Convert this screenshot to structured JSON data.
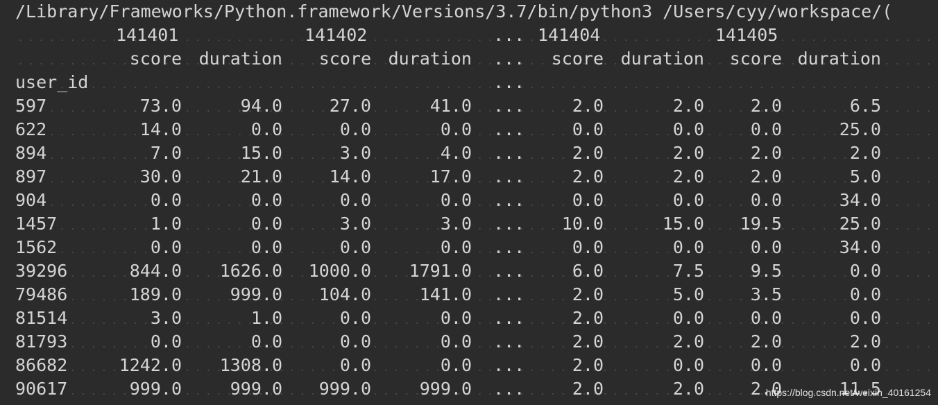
{
  "console": {
    "command_line": "/Library/Frameworks/Python.framework/Versions/3.7/bin/python3 /Users/cyy/workspace/(",
    "ellipsis": "...",
    "index_name": "user_id",
    "column_groups": [
      "141401",
      "141402",
      "141404",
      "141405"
    ],
    "sub_headers": [
      "score",
      "duration",
      "score",
      "duration",
      "score",
      "duration",
      "score",
      "duration"
    ],
    "rows": [
      {
        "id": "597",
        "values": [
          "73.0",
          "94.0",
          "27.0",
          "41.0",
          "2.0",
          "2.0",
          "2.0",
          "6.5"
        ]
      },
      {
        "id": "622",
        "values": [
          "14.0",
          "0.0",
          "0.0",
          "0.0",
          "0.0",
          "0.0",
          "0.0",
          "25.0"
        ]
      },
      {
        "id": "894",
        "values": [
          "7.0",
          "15.0",
          "3.0",
          "4.0",
          "2.0",
          "2.0",
          "2.0",
          "2.0"
        ]
      },
      {
        "id": "897",
        "values": [
          "30.0",
          "21.0",
          "14.0",
          "17.0",
          "2.0",
          "2.0",
          "2.0",
          "5.0"
        ]
      },
      {
        "id": "904",
        "values": [
          "0.0",
          "0.0",
          "0.0",
          "0.0",
          "0.0",
          "0.0",
          "0.0",
          "34.0"
        ]
      },
      {
        "id": "1457",
        "values": [
          "1.0",
          "0.0",
          "3.0",
          "3.0",
          "10.0",
          "15.0",
          "19.5",
          "25.0"
        ]
      },
      {
        "id": "1562",
        "values": [
          "0.0",
          "0.0",
          "0.0",
          "0.0",
          "0.0",
          "0.0",
          "0.0",
          "34.0"
        ]
      },
      {
        "id": "39296",
        "values": [
          "844.0",
          "1626.0",
          "1000.0",
          "1791.0",
          "6.0",
          "7.5",
          "9.5",
          "0.0"
        ]
      },
      {
        "id": "79486",
        "values": [
          "189.0",
          "999.0",
          "104.0",
          "141.0",
          "2.0",
          "5.0",
          "3.5",
          "0.0"
        ]
      },
      {
        "id": "81514",
        "values": [
          "3.0",
          "1.0",
          "0.0",
          "0.0",
          "2.0",
          "0.0",
          "0.0",
          "0.0"
        ]
      },
      {
        "id": "81793",
        "values": [
          "0.0",
          "0.0",
          "0.0",
          "0.0",
          "2.0",
          "2.0",
          "2.0",
          "2.0"
        ]
      },
      {
        "id": "86682",
        "values": [
          "1242.0",
          "1308.0",
          "0.0",
          "0.0",
          "2.0",
          "0.0",
          "0.0",
          "0.0"
        ]
      },
      {
        "id": "90617",
        "values": [
          "999.0",
          "999.0",
          "999.0",
          "999.0",
          "2.0",
          "2.0",
          "2.0",
          "11.5"
        ]
      }
    ]
  },
  "watermark": "https://blog.csdn.net/weixin_40161254"
}
